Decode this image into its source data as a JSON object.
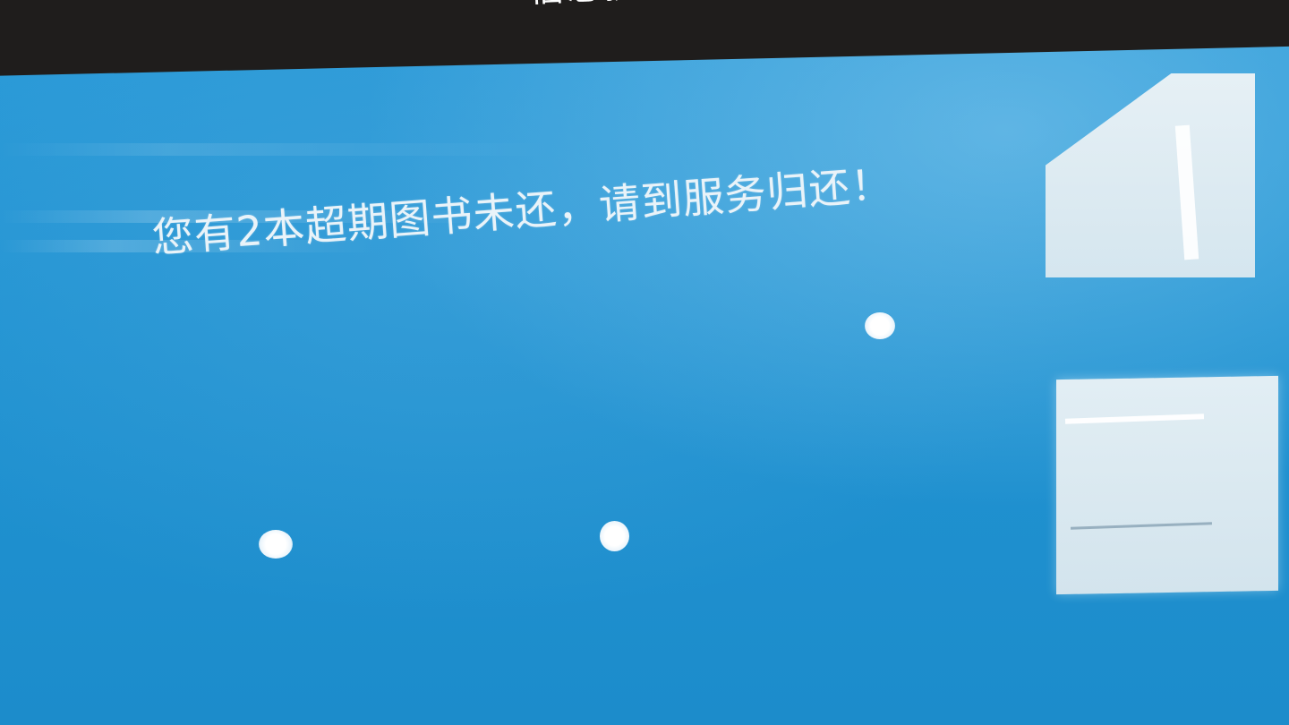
{
  "window": {
    "title": "信息提示"
  },
  "main": {
    "message": "您有2本超期图书未还，请到服务归还！"
  },
  "colors": {
    "background": "#2193d2",
    "title_bar": "#1f1d1c",
    "text": "#e9f3f9"
  }
}
